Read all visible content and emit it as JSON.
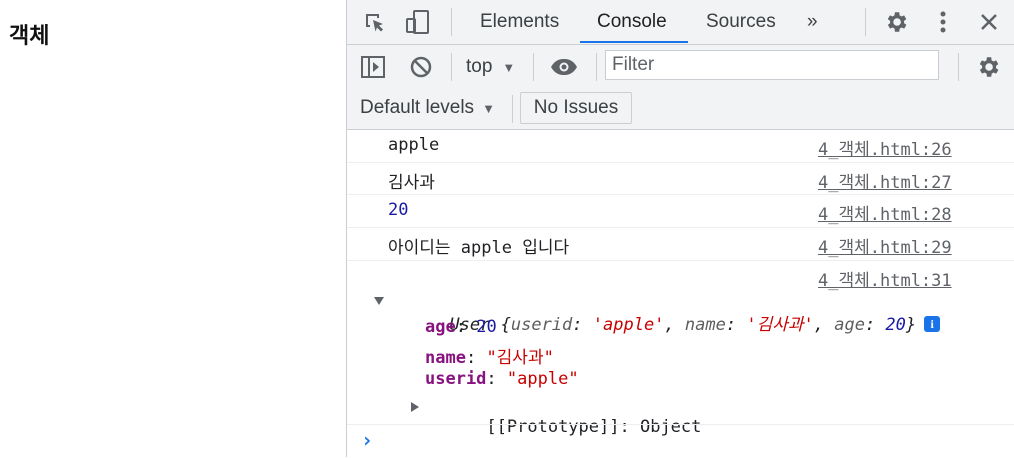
{
  "page": {
    "title": "객체"
  },
  "devtools": {
    "tabs": [
      {
        "label": "Elements",
        "active": false
      },
      {
        "label": "Console",
        "active": true
      },
      {
        "label": "Sources",
        "active": false
      }
    ],
    "more_tabs": "»",
    "toolbar": {
      "context": "top",
      "filter_placeholder": "Filter",
      "levels": "Default levels",
      "issues": "No Issues"
    },
    "icons": [
      "inspect-icon",
      "device-icon",
      "gear-icon",
      "kebab-icon",
      "close-icon",
      "sidebar-icon",
      "clear-icon",
      "eye-icon"
    ],
    "accent": "#1a73e8"
  },
  "console": {
    "messages": [
      {
        "text": "apple",
        "source": "4_객체.html:26",
        "kind": "string"
      },
      {
        "text": "김사과",
        "source": "4_객체.html:27",
        "kind": "string"
      },
      {
        "text": "20",
        "source": "4_객체.html:28",
        "kind": "number"
      },
      {
        "text": "아이디는 apple 입니다",
        "source": "4_객체.html:29",
        "kind": "string"
      }
    ],
    "object_log": {
      "source": "4_객체.html:31",
      "class_name": "User",
      "summary": [
        {
          "key": "userid",
          "value": "'apple'",
          "kind": "string"
        },
        {
          "key": "name",
          "value": "'김사과'",
          "kind": "string"
        },
        {
          "key": "age",
          "value": "20",
          "kind": "number"
        }
      ],
      "properties": [
        {
          "key": "age",
          "value": "20",
          "kind": "number"
        },
        {
          "key": "name",
          "value": "\"김사과\"",
          "kind": "string"
        },
        {
          "key": "userid",
          "value": "\"apple\"",
          "kind": "string"
        }
      ],
      "prototype": {
        "key": "[[Prototype]]",
        "value": "Object"
      }
    },
    "prompt": "›"
  }
}
